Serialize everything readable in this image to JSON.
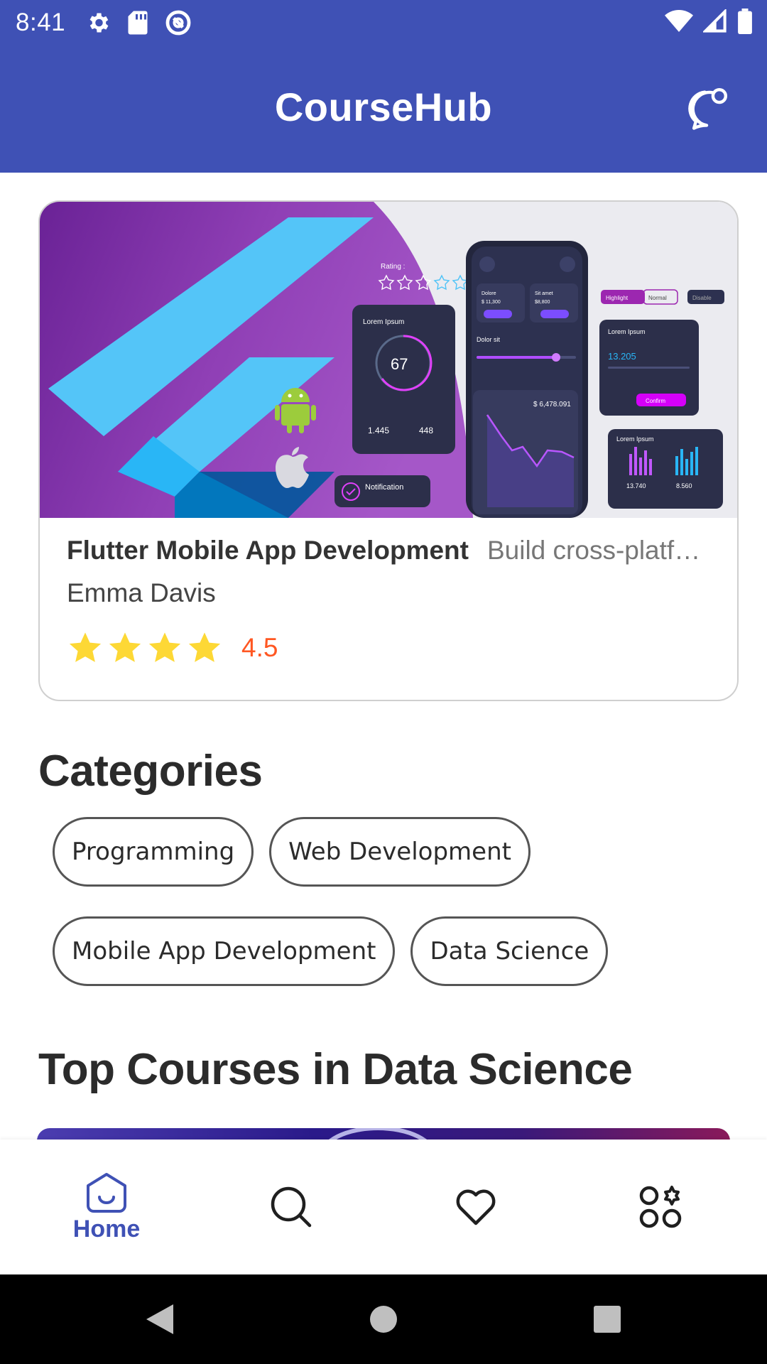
{
  "status_bar": {
    "time": "8:41",
    "left_icons": [
      "settings-icon",
      "sd-card-icon",
      "sync-icon"
    ],
    "right_icons": [
      "wifi-icon",
      "signal-icon",
      "battery-icon"
    ]
  },
  "app_bar": {
    "title": "CourseHub",
    "action_icon": "chat-bubble-icon"
  },
  "featured_course": {
    "title": "Flutter Mobile App Development",
    "description": "Build cross-platf…",
    "author": "Emma Davis",
    "rating": "4.5",
    "stars_filled": 4,
    "banner_texts": {
      "rating_label": "Rating :",
      "lorem1": "Lorem Ipsum",
      "percent": "67",
      "dollar1": "1.445",
      "dollar2": "448",
      "dolore": "Dolore",
      "dolore_val": "$ 11,300",
      "sitamet": "Sit amet",
      "sitamet_val": "$8,800",
      "dolor_sit": "Dolor sit",
      "amount": "$ 6,478.091",
      "highlight": "Highlight",
      "normal": "Normal",
      "disable": "Disable",
      "value1": "13.205",
      "confirm": "Confirm",
      "val_a": "13.740",
      "val_b": "8.560",
      "notification": "Notification"
    }
  },
  "categories": {
    "title": "Categories",
    "items": [
      "Programming",
      "Web Development",
      "Mobile App Development",
      "Data Science"
    ]
  },
  "top_courses": {
    "title": "Top Courses in Data Science"
  },
  "bottom_nav": {
    "items": [
      {
        "label": "Home",
        "icon": "home-icon",
        "active": true
      },
      {
        "label": "",
        "icon": "search-icon",
        "active": false
      },
      {
        "label": "",
        "icon": "heart-icon",
        "active": false
      },
      {
        "label": "",
        "icon": "apps-icon",
        "active": false
      }
    ]
  },
  "colors": {
    "primary": "#3f51b5",
    "rating": "#ff5722",
    "star": "#fdd835"
  }
}
